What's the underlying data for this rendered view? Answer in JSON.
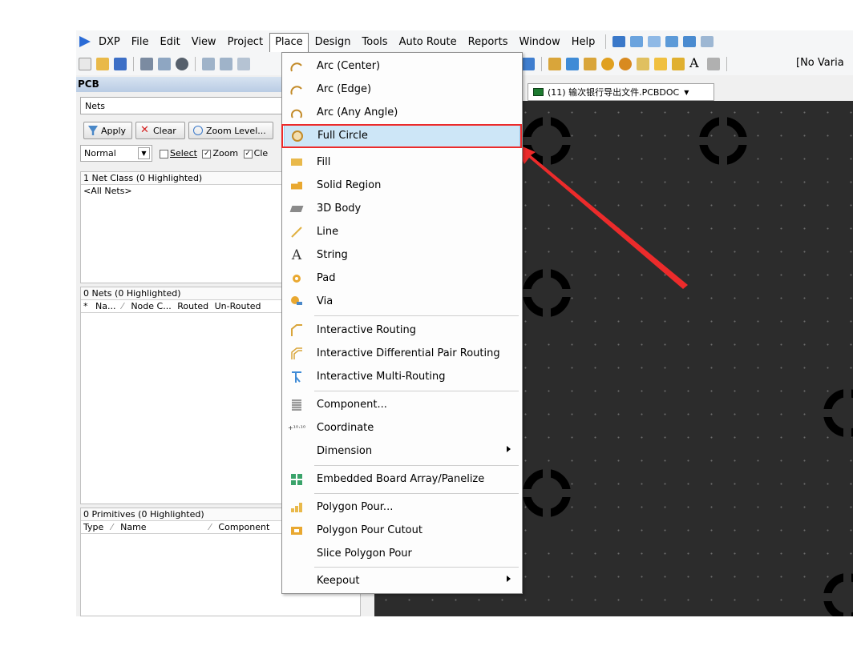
{
  "menubar": {
    "logo_label": "DXP",
    "items": [
      {
        "label": "File"
      },
      {
        "label": "Edit"
      },
      {
        "label": "View"
      },
      {
        "label": "Project"
      },
      {
        "label": "Place"
      },
      {
        "label": "Design"
      },
      {
        "label": "Tools"
      },
      {
        "label": "Auto Route"
      },
      {
        "label": "Reports"
      },
      {
        "label": "Window"
      },
      {
        "label": "Help"
      }
    ]
  },
  "toolbar": {
    "variant_label": "[No Varia"
  },
  "panel": {
    "title": "PCB",
    "mode_value": "Nets",
    "apply_label": "Apply",
    "clear_label": "Clear",
    "zoom_label": "Zoom Level...",
    "normal_value": "Normal",
    "select_label": "Select",
    "zoom_chk_label": "Zoom",
    "clear_chk_label": "Cle",
    "net_class": {
      "header": "1 Net Class (0 Highlighted)",
      "row": "<All Nets>"
    },
    "nets": {
      "header": "0 Nets (0 Highlighted)",
      "columns": [
        "*",
        "Na...",
        "Node C...",
        "Routed",
        "Un-Routed"
      ]
    },
    "primitives": {
      "header": "0 Primitives (0 Highlighted)",
      "columns": [
        "Type",
        "Name",
        "Component"
      ]
    }
  },
  "document_tab": {
    "label": "(11) 输次银行导出文件.PCBDOC"
  },
  "place_menu": {
    "items": [
      {
        "label": "Arc (Center)",
        "icon": "arc-center-icon"
      },
      {
        "label": "Arc (Edge)",
        "icon": "arc-edge-icon"
      },
      {
        "label": "Arc (Any Angle)",
        "icon": "arc-any-angle-icon"
      },
      {
        "label": "Full Circle",
        "icon": "full-circle-icon",
        "highlighted": true
      },
      {
        "label": "Fill",
        "icon": "fill-icon"
      },
      {
        "label": "Solid Region",
        "icon": "solid-region-icon"
      },
      {
        "label": "3D Body",
        "icon": "3d-body-icon"
      },
      {
        "label": "Line",
        "icon": "line-icon"
      },
      {
        "label": "String",
        "icon": "string-icon"
      },
      {
        "label": "Pad",
        "icon": "pad-icon"
      },
      {
        "label": "Via",
        "icon": "via-icon"
      },
      {
        "label": "Interactive Routing",
        "icon": "interactive-routing-icon"
      },
      {
        "label": "Interactive Differential Pair Routing",
        "icon": "diff-pair-routing-icon"
      },
      {
        "label": "Interactive Multi-Routing",
        "icon": "multi-routing-icon"
      },
      {
        "label": "Component...",
        "icon": "component-icon"
      },
      {
        "label": "Coordinate",
        "icon": "coordinate-icon"
      },
      {
        "label": "Dimension",
        "icon": "",
        "submenu": true
      },
      {
        "label": "Embedded Board Array/Panelize",
        "icon": "embedded-board-icon"
      },
      {
        "label": "Polygon Pour...",
        "icon": "polygon-pour-icon"
      },
      {
        "label": "Polygon Pour Cutout",
        "icon": "polygon-cutout-icon"
      },
      {
        "label": "Slice Polygon Pour",
        "icon": ""
      },
      {
        "label": "Keepout",
        "icon": "",
        "submenu": true
      }
    ]
  },
  "colors": {
    "highlight_box": "#ec2b2b",
    "menu_hover": "#cde6f7",
    "canvas": "#2c2c2c"
  }
}
